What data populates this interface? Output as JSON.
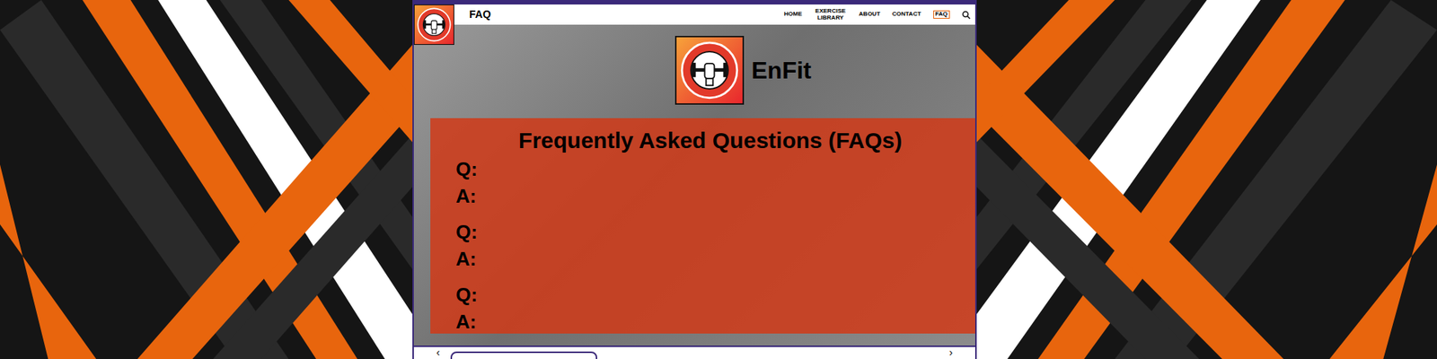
{
  "page": {
    "title": "FAQ"
  },
  "nav": [
    {
      "label": "HOME",
      "selected": false
    },
    {
      "label": "EXERCISE LIBRARY",
      "selected": false
    },
    {
      "label": "ABOUT",
      "selected": false
    },
    {
      "label": "CONTACT",
      "selected": false
    },
    {
      "label": "FAQ",
      "selected": true
    }
  ],
  "brand": "EnFit",
  "faq": {
    "title": "Frequently Asked Questions (FAQs)",
    "items": [
      {
        "question": "Q:",
        "answer": "A:"
      },
      {
        "question": "Q:",
        "answer": "A:"
      },
      {
        "question": "Q:",
        "answer": "A:"
      }
    ]
  },
  "pager": {
    "prev": "‹",
    "next": "›"
  }
}
